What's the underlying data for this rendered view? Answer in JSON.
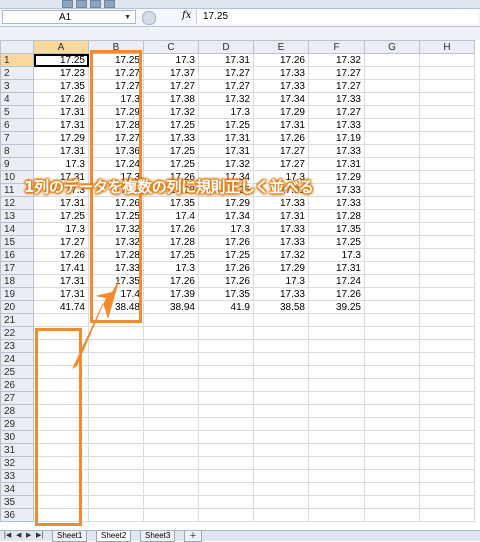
{
  "formula_bar": {
    "cell_ref": "A1",
    "fx_label": "fx",
    "formula": "17.25"
  },
  "columns": [
    "A",
    "B",
    "C",
    "D",
    "E",
    "F",
    "G",
    "H"
  ],
  "rows": [
    [
      "17.25",
      "17.25",
      "17.3",
      "17.31",
      "17.26",
      "17.32"
    ],
    [
      "17.23",
      "17.27",
      "17.37",
      "17.27",
      "17.33",
      "17.27"
    ],
    [
      "17.35",
      "17.27",
      "17.27",
      "17.27",
      "17.33",
      "17.27"
    ],
    [
      "17.26",
      "17.3",
      "17.38",
      "17.32",
      "17.34",
      "17.33"
    ],
    [
      "17.31",
      "17.29",
      "17.32",
      "17.3",
      "17.29",
      "17.27"
    ],
    [
      "17.31",
      "17.28",
      "17.25",
      "17.25",
      "17.31",
      "17.33"
    ],
    [
      "17.29",
      "17.27",
      "17.33",
      "17.31",
      "17.26",
      "17.19"
    ],
    [
      "17.31",
      "17.36",
      "17.25",
      "17.31",
      "17.27",
      "17.33"
    ],
    [
      "17.3",
      "17.24",
      "17.25",
      "17.32",
      "17.27",
      "17.31"
    ],
    [
      "17.31",
      "17.3",
      "17.26",
      "17.34",
      "17.3",
      "17.29"
    ],
    [
      "17.3",
      "17.32",
      "17.28",
      "17.25",
      "17.31",
      "17.33"
    ],
    [
      "17.31",
      "17.26",
      "17.35",
      "17.29",
      "17.33",
      "17.33"
    ],
    [
      "17.25",
      "17.25",
      "17.4",
      "17.34",
      "17.31",
      "17.28"
    ],
    [
      "17.3",
      "17.32",
      "17.26",
      "17.3",
      "17.33",
      "17.35"
    ],
    [
      "17.27",
      "17.32",
      "17.28",
      "17.26",
      "17.33",
      "17.25"
    ],
    [
      "17.26",
      "17.28",
      "17.25",
      "17.25",
      "17.32",
      "17.3"
    ],
    [
      "17.41",
      "17.33",
      "17.3",
      "17.26",
      "17.29",
      "17.31"
    ],
    [
      "17.31",
      "17.35",
      "17.26",
      "17.26",
      "17.3",
      "17.24"
    ],
    [
      "17.31",
      "17.4",
      "17.39",
      "17.35",
      "17.33",
      "17.26"
    ],
    [
      "41.74",
      "38.48",
      "38.94",
      "41.9",
      "38.58",
      "39.25"
    ]
  ],
  "total_rows": 36,
  "callout_text": "1列のデータを複数の列に規則正しく並べる",
  "accent_color": "#f58a2a",
  "sheet_tabs": [
    "Sheet1",
    "Sheet2",
    "Sheet3"
  ],
  "active_sheet": "Sheet2",
  "icons": [
    "save-icon",
    "undo-icon",
    "redo-icon",
    "fx-icon",
    "tab-first-icon",
    "tab-prev-icon",
    "tab-next-icon",
    "tab-last-icon"
  ]
}
